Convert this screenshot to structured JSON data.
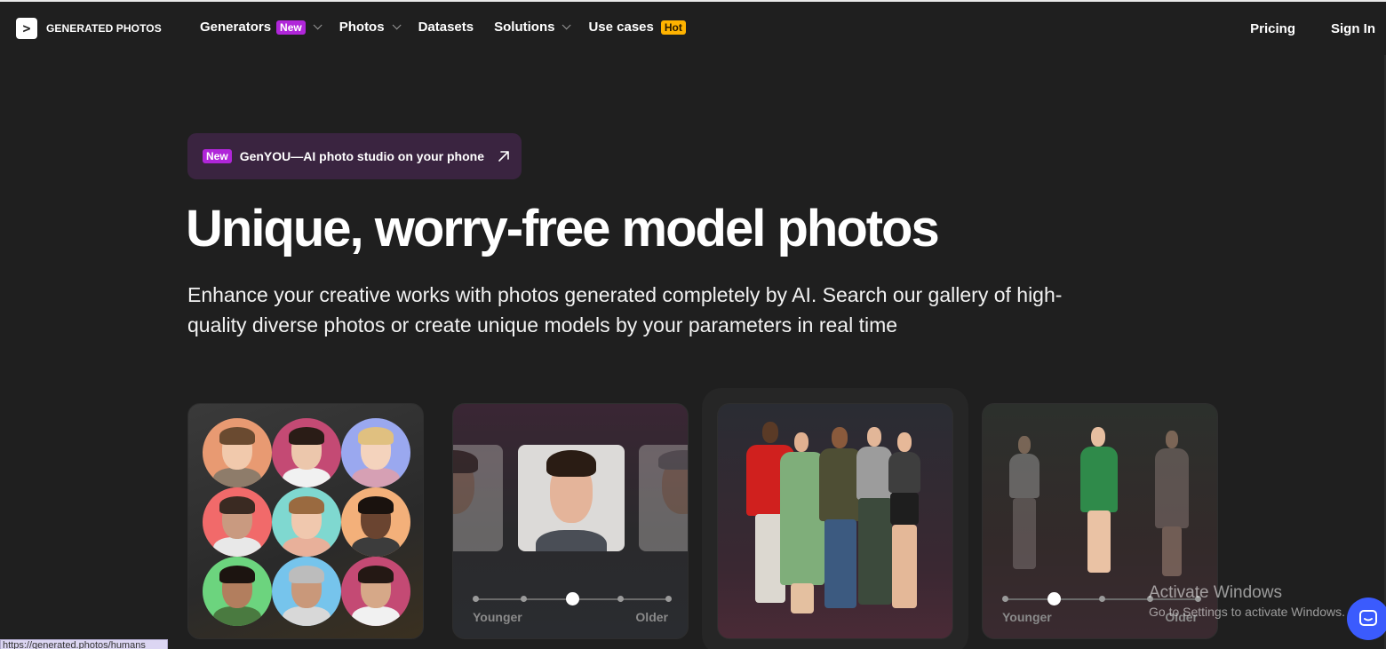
{
  "nav": {
    "logo_mark": ">",
    "logo_text": "GENERATED PHOTOS",
    "items": [
      {
        "label": "Generators",
        "badge": "New",
        "dropdown": true
      },
      {
        "label": "Photos",
        "badge": "",
        "dropdown": true
      },
      {
        "label": "Datasets",
        "badge": "",
        "dropdown": false
      },
      {
        "label": "Solutions",
        "badge": "",
        "dropdown": true
      },
      {
        "label": "Use cases",
        "badge": "Hot",
        "dropdown": false
      }
    ],
    "pricing": "Pricing",
    "sign_in": "Sign In"
  },
  "promo": {
    "badge": "New",
    "text": "GenYOU—AI photo studio on your phone",
    "icon": "arrow-up-right-icon"
  },
  "hero": {
    "title": "Unique, worry-free model photos",
    "subtitle": "Enhance your creative works with photos generated completely by AI. Search our gallery of high-quality diverse photos or create unique models by your parameters in real time"
  },
  "cards": {
    "age_slider_1": {
      "left_label": "Younger",
      "right_label": "Older",
      "value_fraction": 0.5
    },
    "age_slider_2": {
      "left_label": "Younger",
      "right_label": "Older",
      "value_fraction": 0.25
    }
  },
  "status_bar": {
    "url": "https://generated.photos/humans"
  },
  "watermark": {
    "line1": "Activate Windows",
    "line2": "Go to Settings to activate Windows."
  },
  "colors": {
    "background": "#1f1f1f",
    "badge_new": "#b026d9",
    "badge_hot": "#ffb300",
    "chat_button": "#3b5bfd"
  }
}
